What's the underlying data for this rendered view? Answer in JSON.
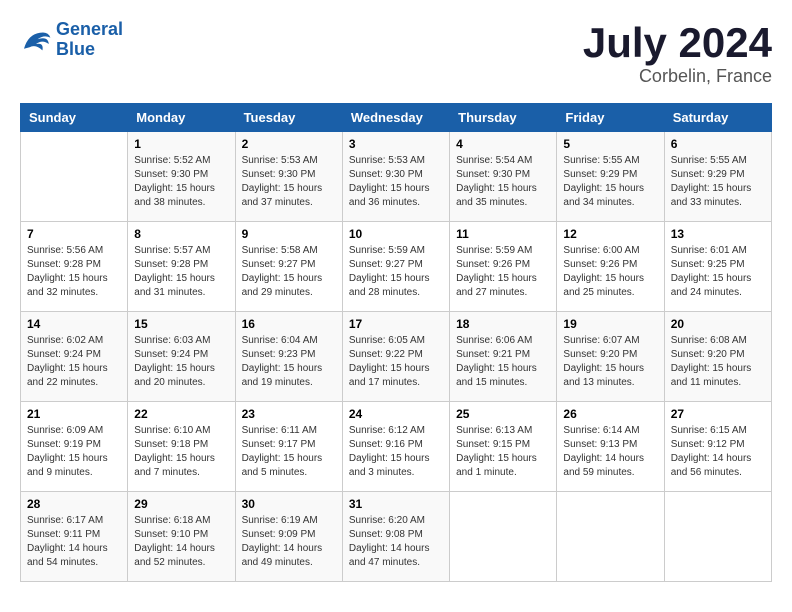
{
  "header": {
    "logo_line1": "General",
    "logo_line2": "Blue",
    "title": "July 2024",
    "subtitle": "Corbelin, France"
  },
  "days_of_week": [
    "Sunday",
    "Monday",
    "Tuesday",
    "Wednesday",
    "Thursday",
    "Friday",
    "Saturday"
  ],
  "weeks": [
    [
      {
        "num": "",
        "info": ""
      },
      {
        "num": "1",
        "info": "Sunrise: 5:52 AM\nSunset: 9:30 PM\nDaylight: 15 hours\nand 38 minutes."
      },
      {
        "num": "2",
        "info": "Sunrise: 5:53 AM\nSunset: 9:30 PM\nDaylight: 15 hours\nand 37 minutes."
      },
      {
        "num": "3",
        "info": "Sunrise: 5:53 AM\nSunset: 9:30 PM\nDaylight: 15 hours\nand 36 minutes."
      },
      {
        "num": "4",
        "info": "Sunrise: 5:54 AM\nSunset: 9:30 PM\nDaylight: 15 hours\nand 35 minutes."
      },
      {
        "num": "5",
        "info": "Sunrise: 5:55 AM\nSunset: 9:29 PM\nDaylight: 15 hours\nand 34 minutes."
      },
      {
        "num": "6",
        "info": "Sunrise: 5:55 AM\nSunset: 9:29 PM\nDaylight: 15 hours\nand 33 minutes."
      }
    ],
    [
      {
        "num": "7",
        "info": "Sunrise: 5:56 AM\nSunset: 9:28 PM\nDaylight: 15 hours\nand 32 minutes."
      },
      {
        "num": "8",
        "info": "Sunrise: 5:57 AM\nSunset: 9:28 PM\nDaylight: 15 hours\nand 31 minutes."
      },
      {
        "num": "9",
        "info": "Sunrise: 5:58 AM\nSunset: 9:27 PM\nDaylight: 15 hours\nand 29 minutes."
      },
      {
        "num": "10",
        "info": "Sunrise: 5:59 AM\nSunset: 9:27 PM\nDaylight: 15 hours\nand 28 minutes."
      },
      {
        "num": "11",
        "info": "Sunrise: 5:59 AM\nSunset: 9:26 PM\nDaylight: 15 hours\nand 27 minutes."
      },
      {
        "num": "12",
        "info": "Sunrise: 6:00 AM\nSunset: 9:26 PM\nDaylight: 15 hours\nand 25 minutes."
      },
      {
        "num": "13",
        "info": "Sunrise: 6:01 AM\nSunset: 9:25 PM\nDaylight: 15 hours\nand 24 minutes."
      }
    ],
    [
      {
        "num": "14",
        "info": "Sunrise: 6:02 AM\nSunset: 9:24 PM\nDaylight: 15 hours\nand 22 minutes."
      },
      {
        "num": "15",
        "info": "Sunrise: 6:03 AM\nSunset: 9:24 PM\nDaylight: 15 hours\nand 20 minutes."
      },
      {
        "num": "16",
        "info": "Sunrise: 6:04 AM\nSunset: 9:23 PM\nDaylight: 15 hours\nand 19 minutes."
      },
      {
        "num": "17",
        "info": "Sunrise: 6:05 AM\nSunset: 9:22 PM\nDaylight: 15 hours\nand 17 minutes."
      },
      {
        "num": "18",
        "info": "Sunrise: 6:06 AM\nSunset: 9:21 PM\nDaylight: 15 hours\nand 15 minutes."
      },
      {
        "num": "19",
        "info": "Sunrise: 6:07 AM\nSunset: 9:20 PM\nDaylight: 15 hours\nand 13 minutes."
      },
      {
        "num": "20",
        "info": "Sunrise: 6:08 AM\nSunset: 9:20 PM\nDaylight: 15 hours\nand 11 minutes."
      }
    ],
    [
      {
        "num": "21",
        "info": "Sunrise: 6:09 AM\nSunset: 9:19 PM\nDaylight: 15 hours\nand 9 minutes."
      },
      {
        "num": "22",
        "info": "Sunrise: 6:10 AM\nSunset: 9:18 PM\nDaylight: 15 hours\nand 7 minutes."
      },
      {
        "num": "23",
        "info": "Sunrise: 6:11 AM\nSunset: 9:17 PM\nDaylight: 15 hours\nand 5 minutes."
      },
      {
        "num": "24",
        "info": "Sunrise: 6:12 AM\nSunset: 9:16 PM\nDaylight: 15 hours\nand 3 minutes."
      },
      {
        "num": "25",
        "info": "Sunrise: 6:13 AM\nSunset: 9:15 PM\nDaylight: 15 hours\nand 1 minute."
      },
      {
        "num": "26",
        "info": "Sunrise: 6:14 AM\nSunset: 9:13 PM\nDaylight: 14 hours\nand 59 minutes."
      },
      {
        "num": "27",
        "info": "Sunrise: 6:15 AM\nSunset: 9:12 PM\nDaylight: 14 hours\nand 56 minutes."
      }
    ],
    [
      {
        "num": "28",
        "info": "Sunrise: 6:17 AM\nSunset: 9:11 PM\nDaylight: 14 hours\nand 54 minutes."
      },
      {
        "num": "29",
        "info": "Sunrise: 6:18 AM\nSunset: 9:10 PM\nDaylight: 14 hours\nand 52 minutes."
      },
      {
        "num": "30",
        "info": "Sunrise: 6:19 AM\nSunset: 9:09 PM\nDaylight: 14 hours\nand 49 minutes."
      },
      {
        "num": "31",
        "info": "Sunrise: 6:20 AM\nSunset: 9:08 PM\nDaylight: 14 hours\nand 47 minutes."
      },
      {
        "num": "",
        "info": ""
      },
      {
        "num": "",
        "info": ""
      },
      {
        "num": "",
        "info": ""
      }
    ]
  ]
}
